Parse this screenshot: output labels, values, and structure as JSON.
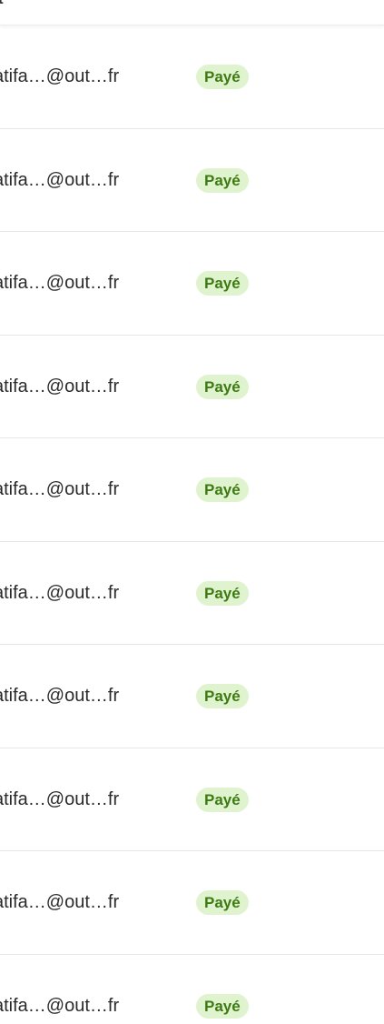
{
  "header": {
    "column_label": "ent"
  },
  "rows": [
    {
      "email": "atifa…@out…fr",
      "status": "Payé"
    },
    {
      "email": "atifa…@out…fr",
      "status": "Payé"
    },
    {
      "email": "atifa…@out…fr",
      "status": "Payé"
    },
    {
      "email": "atifa…@out…fr",
      "status": "Payé"
    },
    {
      "email": "atifa…@out…fr",
      "status": "Payé"
    },
    {
      "email": "atifa…@out…fr",
      "status": "Payé"
    },
    {
      "email": "atifa…@out…fr",
      "status": "Payé"
    },
    {
      "email": "atifa…@out…fr",
      "status": "Payé"
    },
    {
      "email": "atifa…@out…fr",
      "status": "Payé"
    },
    {
      "email": "atifa…@out…fr",
      "status": "Payé"
    }
  ],
  "colors": {
    "badge_background": "#dff3cf",
    "badge_text": "#3e7a12",
    "divider": "#e6e6e6"
  }
}
